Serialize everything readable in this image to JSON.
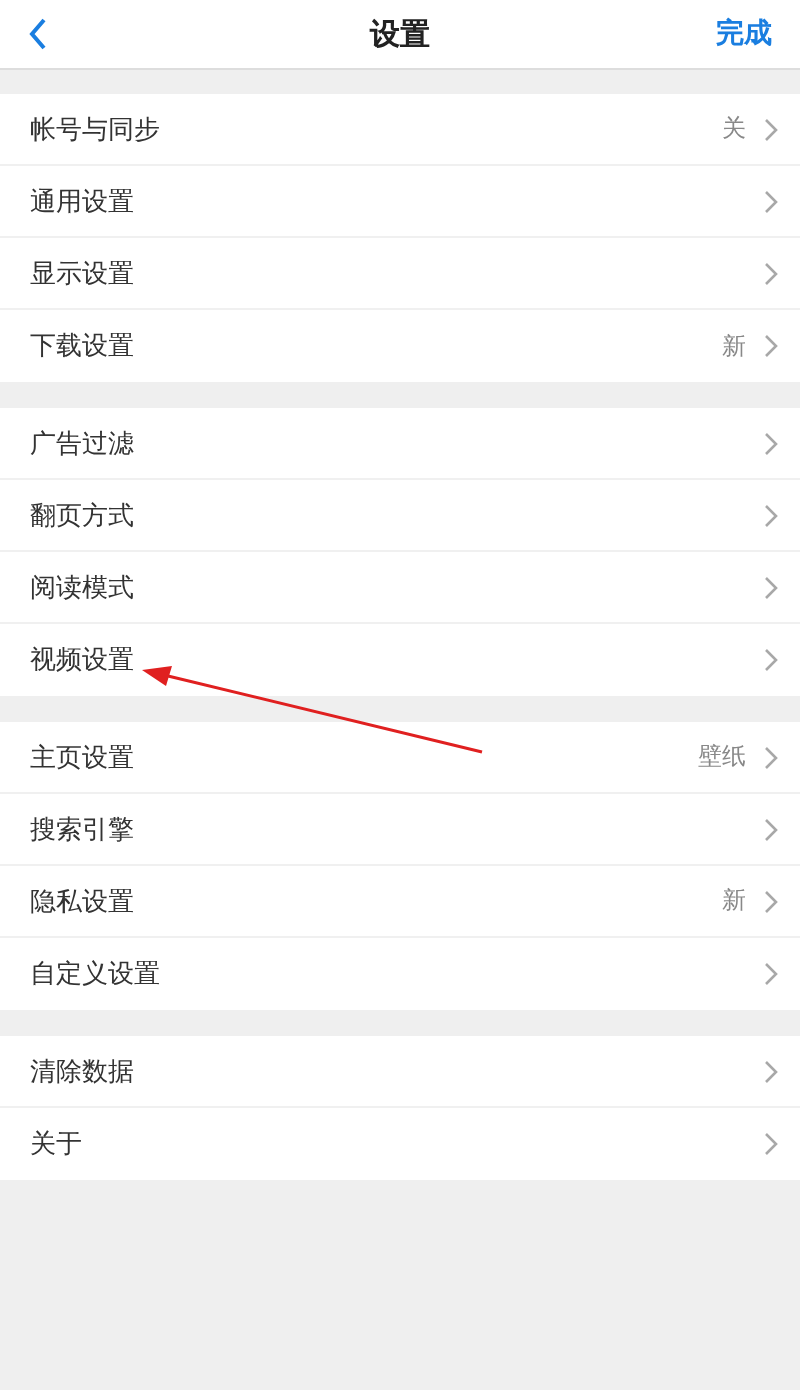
{
  "header": {
    "title": "设置",
    "done": "完成"
  },
  "groups": [
    {
      "items": [
        {
          "label": "帐号与同步",
          "value": "关"
        },
        {
          "label": "通用设置"
        },
        {
          "label": "显示设置"
        },
        {
          "label": "下载设置",
          "value": "新"
        }
      ]
    },
    {
      "items": [
        {
          "label": "广告过滤"
        },
        {
          "label": "翻页方式"
        },
        {
          "label": "阅读模式"
        },
        {
          "label": "视频设置"
        }
      ]
    },
    {
      "items": [
        {
          "label": "主页设置",
          "value": "壁纸"
        },
        {
          "label": "搜索引擎"
        },
        {
          "label": "隐私设置",
          "value": "新"
        },
        {
          "label": "自定义设置"
        }
      ]
    },
    {
      "items": [
        {
          "label": "清除数据"
        },
        {
          "label": "关于"
        }
      ]
    }
  ]
}
